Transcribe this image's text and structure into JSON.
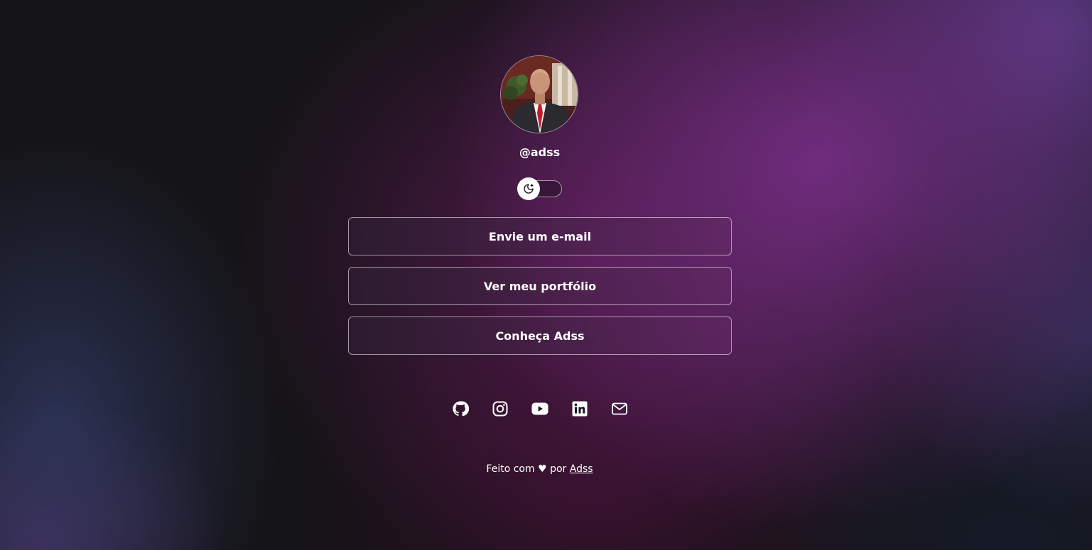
{
  "profile": {
    "handle": "@adss"
  },
  "theme_toggle": {
    "icon": "moon-stars-icon",
    "state": "off"
  },
  "links": [
    {
      "label": "Envie um e-mail"
    },
    {
      "label": "Ver meu portfólio"
    },
    {
      "label": "Conheça Adss"
    }
  ],
  "social": [
    {
      "icon": "github-icon"
    },
    {
      "icon": "instagram-icon"
    },
    {
      "icon": "youtube-icon"
    },
    {
      "icon": "linkedin-icon"
    },
    {
      "icon": "mail-icon"
    }
  ],
  "footer": {
    "made_with": "Feito com",
    "heart": "♥",
    "by": "por",
    "author": "Adss"
  },
  "colors": {
    "text": "#ffffff",
    "background": "#141316",
    "accent": "#7c308c"
  }
}
